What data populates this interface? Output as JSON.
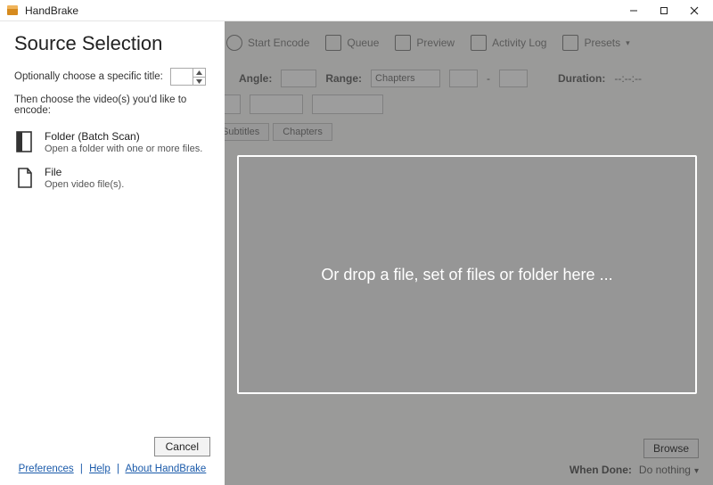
{
  "app": {
    "title": "HandBrake"
  },
  "window": {
    "minimize": "Minimize",
    "maximize": "Maximize",
    "close": "Close"
  },
  "toolbar": {
    "start_encode": "Start Encode",
    "queue": "Queue",
    "preview": "Preview",
    "activity_log": "Activity Log",
    "presets": "Presets"
  },
  "bg": {
    "angle_label": "Angle:",
    "range_label": "Range:",
    "range_value": "Chapters",
    "range_to_sep": "-",
    "duration_label": "Duration:",
    "duration_value": "--:--:--",
    "tabs": {
      "subtitles": "Subtitles",
      "chapters": "Chapters"
    },
    "browse": "Browse",
    "when_done_label": "When Done:",
    "when_done_value": "Do nothing"
  },
  "source": {
    "heading": "Source Selection",
    "specific_title_label": "Optionally choose a specific title:",
    "specific_title_value": "",
    "then_choose": "Then choose the video(s) you'd like to encode:",
    "folder_opt": {
      "title": "Folder (Batch Scan)",
      "sub": "Open a folder with one or more files."
    },
    "file_opt": {
      "title": "File",
      "sub": "Open video file(s)."
    },
    "cancel": "Cancel",
    "links": {
      "preferences": "Preferences",
      "help": "Help",
      "about": "About HandBrake"
    }
  },
  "dropzone": {
    "text": "Or drop a file, set of files or folder here ..."
  }
}
